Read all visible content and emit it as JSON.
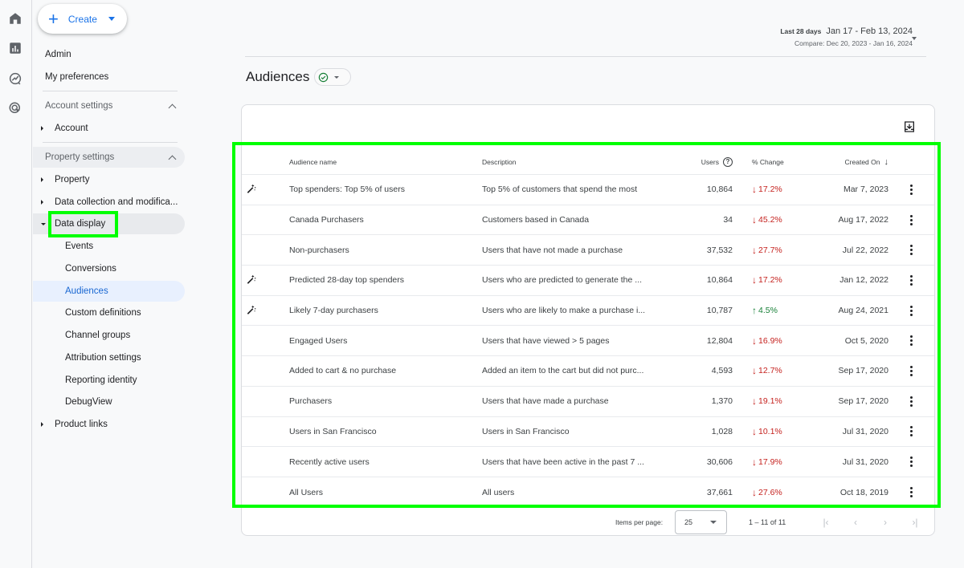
{
  "rail": {
    "icons": [
      "home-icon",
      "reports-icon",
      "explore-icon",
      "advertising-icon"
    ]
  },
  "create_button": {
    "label": "Create"
  },
  "sidebar": {
    "top_items": [
      {
        "label": "Admin"
      },
      {
        "label": "My preferences"
      }
    ],
    "account_settings": {
      "label": "Account settings",
      "items": [
        {
          "label": "Account"
        }
      ]
    },
    "property_settings": {
      "label": "Property settings",
      "groups": [
        {
          "label": "Property"
        },
        {
          "label": "Data collection and modifica..."
        },
        {
          "label": "Data display"
        },
        {
          "label": "Product links"
        }
      ],
      "data_display_children": [
        {
          "label": "Events"
        },
        {
          "label": "Conversions"
        },
        {
          "label": "Audiences",
          "active": true
        },
        {
          "label": "Custom definitions"
        },
        {
          "label": "Channel groups"
        },
        {
          "label": "Attribution settings"
        },
        {
          "label": "Reporting identity"
        },
        {
          "label": "DebugView"
        }
      ]
    }
  },
  "date_range": {
    "label": "Last 28 days",
    "range": "Jan 17 - Feb 13, 2024",
    "compare": "Compare: Dec 20, 2023 - Jan 16, 2024"
  },
  "page": {
    "title": "Audiences",
    "status": "verified"
  },
  "table": {
    "columns": {
      "name": "Audience name",
      "description": "Description",
      "users": "Users",
      "change": "% Change",
      "created": "Created On"
    },
    "rows": [
      {
        "predictive": true,
        "name": "Top spenders: Top 5% of users",
        "description": "Top 5% of customers that spend the most",
        "users": "10,864",
        "change": "17.2%",
        "direction": "down",
        "created": "Mar 7, 2023"
      },
      {
        "predictive": false,
        "name": "Canada Purchasers",
        "description": "Customers based in Canada",
        "users": "34",
        "change": "45.2%",
        "direction": "down",
        "created": "Aug 17, 2022"
      },
      {
        "predictive": false,
        "name": "Non-purchasers",
        "description": "Users that have not made a purchase",
        "users": "37,532",
        "change": "27.7%",
        "direction": "down",
        "created": "Jul 22, 2022"
      },
      {
        "predictive": true,
        "name": "Predicted 28-day top spenders",
        "description": "Users who are predicted to generate the ...",
        "users": "10,864",
        "change": "17.2%",
        "direction": "down",
        "created": "Jan 12, 2022"
      },
      {
        "predictive": true,
        "name": "Likely 7-day purchasers",
        "description": "Users who are likely to make a purchase i...",
        "users": "10,787",
        "change": "4.5%",
        "direction": "up",
        "created": "Aug 24, 2021"
      },
      {
        "predictive": false,
        "name": "Engaged Users",
        "description": "Users that have viewed > 5 pages",
        "users": "12,804",
        "change": "16.9%",
        "direction": "down",
        "created": "Oct 5, 2020"
      },
      {
        "predictive": false,
        "name": "Added to cart & no purchase",
        "description": "Added an item to the cart but did not purc...",
        "users": "4,593",
        "change": "12.7%",
        "direction": "down",
        "created": "Sep 17, 2020"
      },
      {
        "predictive": false,
        "name": "Purchasers",
        "description": "Users that have made a purchase",
        "users": "1,370",
        "change": "19.1%",
        "direction": "down",
        "created": "Sep 17, 2020"
      },
      {
        "predictive": false,
        "name": "Users in San Francisco",
        "description": "Users in San Francisco",
        "users": "1,028",
        "change": "10.1%",
        "direction": "down",
        "created": "Jul 31, 2020"
      },
      {
        "predictive": false,
        "name": "Recently active users",
        "description": "Users that have been active in the past 7 ...",
        "users": "30,606",
        "change": "17.9%",
        "direction": "down",
        "created": "Jul 31, 2020"
      },
      {
        "predictive": false,
        "name": "All Users",
        "description": "All users",
        "users": "37,661",
        "change": "27.6%",
        "direction": "down",
        "created": "Oct 18, 2019"
      }
    ]
  },
  "pagination": {
    "items_per_page_label": "Items per page:",
    "items_per_page": "25",
    "range": "1 – 11 of 11"
  },
  "colors": {
    "negative": "#c5221f",
    "positive": "#188038",
    "accent": "#1a73e8",
    "highlight": "#00ff00"
  }
}
